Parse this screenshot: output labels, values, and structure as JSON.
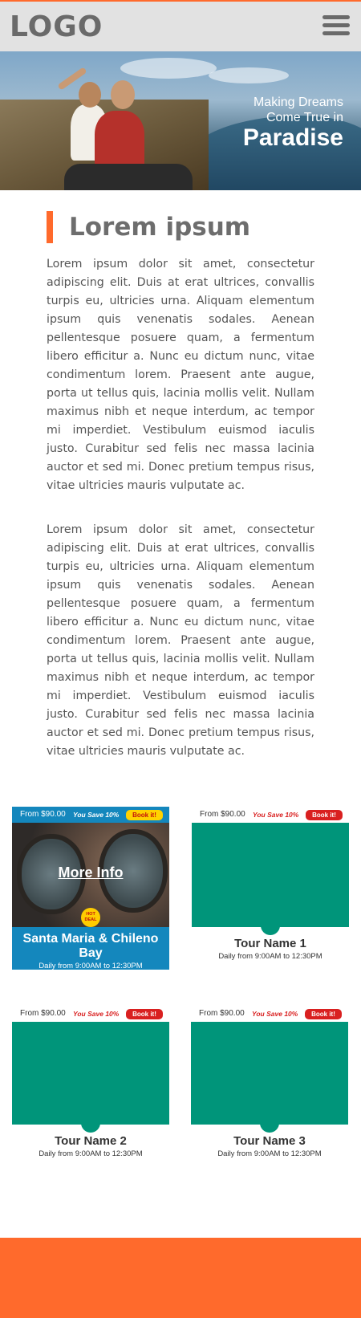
{
  "header": {
    "logo": "LOGO",
    "menu_icon": "hamburger-menu-icon"
  },
  "hero": {
    "line1": "Making Dreams",
    "line2": "Come True in",
    "line3": "Paradise"
  },
  "content": {
    "title": "Lorem ipsum",
    "paragraph1": "Lorem ipsum dolor sit amet, consectetur adipiscing elit. Duis at erat ultrices, convallis turpis eu, ultricies urna. Aliquam elementum ipsum quis venenatis sodales. Aenean pellentesque posuere quam, a fermentum libero efficitur a. Nunc eu dictum nunc, vitae condimentum lorem. Praesent ante augue, porta ut tellus quis, lacinia mollis velit. Nullam maximus nibh et neque interdum, ac tempor mi imperdiet. Vestibulum euismod iaculis justo. Curabitur sed felis nec massa lacinia auctor et sed mi. Donec pretium tempus risus, vitae ultricies mauris vulputate ac.",
    "paragraph2": "Lorem ipsum dolor sit amet, consectetur adipiscing elit. Duis at erat ultrices, convallis turpis eu, ultricies urna. Aliquam elementum ipsum quis venenatis sodales. Aenean pellentesque posuere quam, a fermentum libero efficitur a. Nunc eu dictum nunc, vitae condimentum lorem. Praesent ante augue, porta ut tellus quis, lacinia mollis velit. Nullam maximus nibh et neque interdum, ac tempor mi imperdiet. Vestibulum euismod iaculis justo. Curabitur sed felis nec massa lacinia auctor et sed mi. Donec pretium tempus risus, vitae ultricies mauris vulputate ac."
  },
  "tours": [
    {
      "price": "From $90.00",
      "save": "You Save 10%",
      "book": "Book it!",
      "more_info": "More Info",
      "hot_deal_line1": "HOT",
      "hot_deal_line2": "DEAL",
      "name": "Santa Maria & Chileno Bay",
      "schedule": "Daily from 9:00AM to 12:30PM"
    },
    {
      "price": "From $90.00",
      "save": "You Save 10%",
      "book": "Book it!",
      "name": "Tour Name 1",
      "schedule": "Daily from 9:00AM to 12:30PM"
    },
    {
      "price": "From $90.00",
      "save": "You Save 10%",
      "book": "Book it!",
      "name": "Tour Name 2",
      "schedule": "Daily from 9:00AM to 12:30PM"
    },
    {
      "price": "From $90.00",
      "save": "You Save 10%",
      "book": "Book it!",
      "name": "Tour Name 3",
      "schedule": "Daily from 9:00AM to 12:30PM"
    }
  ],
  "colors": {
    "accent": "#ff6a2c",
    "featured_blue": "#1487bd",
    "placeholder_green": "#00957a",
    "book_red": "#d92020",
    "book_yellow": "#ffd200"
  }
}
